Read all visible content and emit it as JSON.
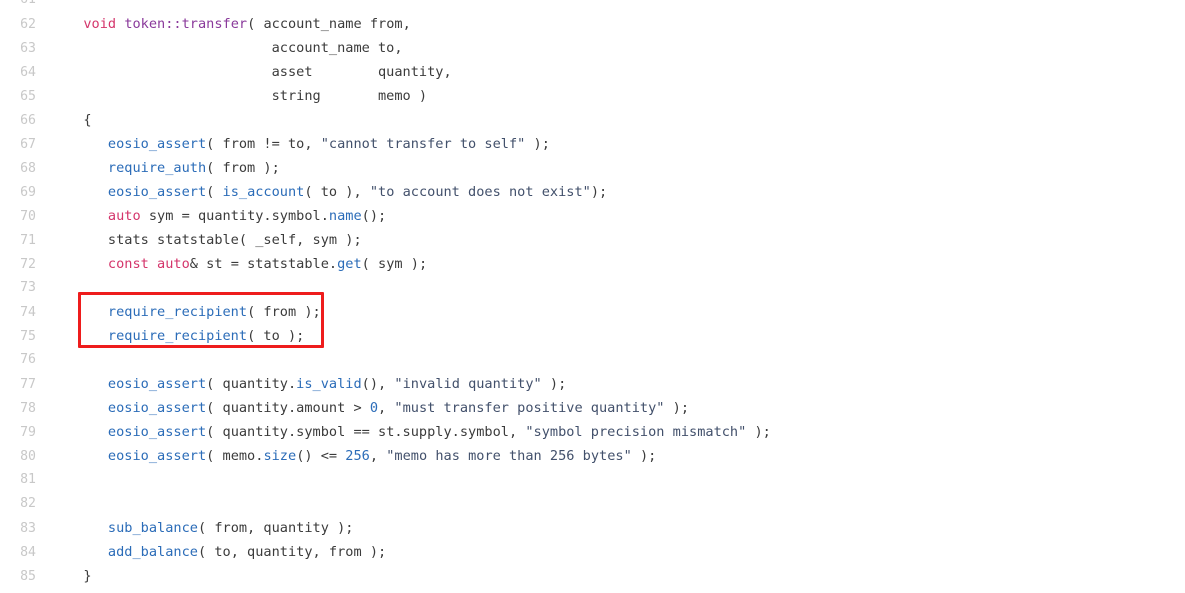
{
  "editor": {
    "language": "cpp",
    "first_visible_line": 61,
    "last_visible_line": 85,
    "background_color": "#ffffff",
    "line_number_color": "#c8c8c8",
    "default_text_color": "#3b3b3b"
  },
  "colors": {
    "keyword": "#d4356b",
    "function_name": "#8a3a9b",
    "function_call": "#2b6cb8",
    "string": "#42506b",
    "number": "#2b6cb8",
    "highlight_box_border": "#ee1c1c"
  },
  "annotation": {
    "type": "rectangle-highlight",
    "color": "#ee1c1c",
    "covers_lines": "74-75",
    "label": ""
  },
  "lines": [
    {
      "number": "61",
      "tokens": []
    },
    {
      "number": "62",
      "tokens": [
        {
          "t": "plain",
          "s": "  "
        },
        {
          "t": "keyword",
          "s": "void"
        },
        {
          "t": "plain",
          "s": " "
        },
        {
          "t": "fnname",
          "s": "token::transfer"
        },
        {
          "t": "plain",
          "s": "( account_name from,"
        }
      ]
    },
    {
      "number": "63",
      "tokens": [
        {
          "t": "plain",
          "s": "                         account_name to,"
        }
      ]
    },
    {
      "number": "64",
      "tokens": [
        {
          "t": "plain",
          "s": "                         asset        quantity,"
        }
      ]
    },
    {
      "number": "65",
      "tokens": [
        {
          "t": "plain",
          "s": "                         string       memo )"
        }
      ]
    },
    {
      "number": "66",
      "tokens": [
        {
          "t": "plain",
          "s": "  {"
        }
      ]
    },
    {
      "number": "67",
      "tokens": [
        {
          "t": "plain",
          "s": "     "
        },
        {
          "t": "func",
          "s": "eosio_assert"
        },
        {
          "t": "plain",
          "s": "( from != to, "
        },
        {
          "t": "string",
          "s": "\"cannot transfer to self\""
        },
        {
          "t": "plain",
          "s": " );"
        }
      ]
    },
    {
      "number": "68",
      "tokens": [
        {
          "t": "plain",
          "s": "     "
        },
        {
          "t": "func",
          "s": "require_auth"
        },
        {
          "t": "plain",
          "s": "( from );"
        }
      ]
    },
    {
      "number": "69",
      "tokens": [
        {
          "t": "plain",
          "s": "     "
        },
        {
          "t": "func",
          "s": "eosio_assert"
        },
        {
          "t": "plain",
          "s": "( "
        },
        {
          "t": "func",
          "s": "is_account"
        },
        {
          "t": "plain",
          "s": "( to ), "
        },
        {
          "t": "string",
          "s": "\"to account does not exist\""
        },
        {
          "t": "plain",
          "s": ");"
        }
      ]
    },
    {
      "number": "70",
      "tokens": [
        {
          "t": "plain",
          "s": "     "
        },
        {
          "t": "keyword",
          "s": "auto"
        },
        {
          "t": "plain",
          "s": " sym = quantity.symbol."
        },
        {
          "t": "func",
          "s": "name"
        },
        {
          "t": "plain",
          "s": "();"
        }
      ]
    },
    {
      "number": "71",
      "tokens": [
        {
          "t": "plain",
          "s": "     stats statstable( _self, sym );"
        }
      ]
    },
    {
      "number": "72",
      "tokens": [
        {
          "t": "plain",
          "s": "     "
        },
        {
          "t": "keyword",
          "s": "const"
        },
        {
          "t": "plain",
          "s": " "
        },
        {
          "t": "keyword",
          "s": "auto"
        },
        {
          "t": "plain",
          "s": "& st = statstable."
        },
        {
          "t": "func",
          "s": "get"
        },
        {
          "t": "plain",
          "s": "( sym );"
        }
      ]
    },
    {
      "number": "73",
      "tokens": []
    },
    {
      "number": "74",
      "tokens": [
        {
          "t": "plain",
          "s": "     "
        },
        {
          "t": "func",
          "s": "require_recipient"
        },
        {
          "t": "plain",
          "s": "( from );"
        }
      ]
    },
    {
      "number": "75",
      "tokens": [
        {
          "t": "plain",
          "s": "     "
        },
        {
          "t": "func",
          "s": "require_recipient"
        },
        {
          "t": "plain",
          "s": "( to );"
        }
      ]
    },
    {
      "number": "76",
      "tokens": []
    },
    {
      "number": "77",
      "tokens": [
        {
          "t": "plain",
          "s": "     "
        },
        {
          "t": "func",
          "s": "eosio_assert"
        },
        {
          "t": "plain",
          "s": "( quantity."
        },
        {
          "t": "func",
          "s": "is_valid"
        },
        {
          "t": "plain",
          "s": "(), "
        },
        {
          "t": "string",
          "s": "\"invalid quantity\""
        },
        {
          "t": "plain",
          "s": " );"
        }
      ]
    },
    {
      "number": "78",
      "tokens": [
        {
          "t": "plain",
          "s": "     "
        },
        {
          "t": "func",
          "s": "eosio_assert"
        },
        {
          "t": "plain",
          "s": "( quantity.amount > "
        },
        {
          "t": "number",
          "s": "0"
        },
        {
          "t": "plain",
          "s": ", "
        },
        {
          "t": "string",
          "s": "\"must transfer positive quantity\""
        },
        {
          "t": "plain",
          "s": " );"
        }
      ]
    },
    {
      "number": "79",
      "tokens": [
        {
          "t": "plain",
          "s": "     "
        },
        {
          "t": "func",
          "s": "eosio_assert"
        },
        {
          "t": "plain",
          "s": "( quantity.symbol == st.supply.symbol, "
        },
        {
          "t": "string",
          "s": "\"symbol precision mismatch\""
        },
        {
          "t": "plain",
          "s": " );"
        }
      ]
    },
    {
      "number": "80",
      "tokens": [
        {
          "t": "plain",
          "s": "     "
        },
        {
          "t": "func",
          "s": "eosio_assert"
        },
        {
          "t": "plain",
          "s": "( memo."
        },
        {
          "t": "func",
          "s": "size"
        },
        {
          "t": "plain",
          "s": "() <= "
        },
        {
          "t": "number",
          "s": "256"
        },
        {
          "t": "plain",
          "s": ", "
        },
        {
          "t": "string",
          "s": "\"memo has more than 256 bytes\""
        },
        {
          "t": "plain",
          "s": " );"
        }
      ]
    },
    {
      "number": "81",
      "tokens": []
    },
    {
      "number": "82",
      "tokens": []
    },
    {
      "number": "83",
      "tokens": [
        {
          "t": "plain",
          "s": "     "
        },
        {
          "t": "func",
          "s": "sub_balance"
        },
        {
          "t": "plain",
          "s": "( from, quantity );"
        }
      ]
    },
    {
      "number": "84",
      "tokens": [
        {
          "t": "plain",
          "s": "     "
        },
        {
          "t": "func",
          "s": "add_balance"
        },
        {
          "t": "plain",
          "s": "( to, quantity, from );"
        }
      ]
    },
    {
      "number": "85",
      "tokens": [
        {
          "t": "plain",
          "s": "  }"
        }
      ]
    }
  ]
}
